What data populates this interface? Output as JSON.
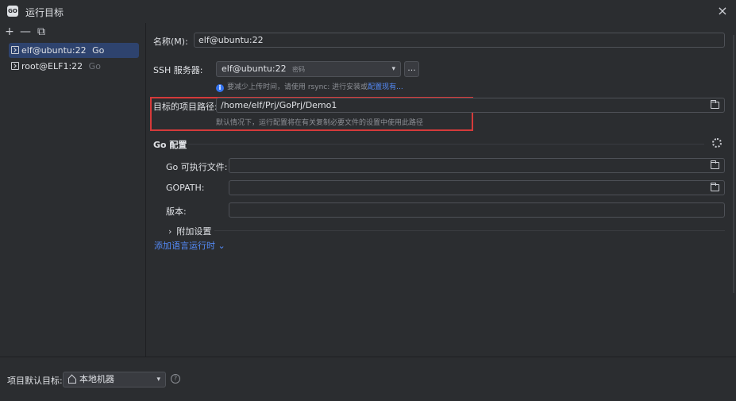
{
  "window": {
    "app_icon_text": "GO",
    "title": "运行目标",
    "close_glyph": "×"
  },
  "sidebar": {
    "toolbar": {
      "add": "+",
      "remove": "—",
      "copy": "⧉"
    },
    "items": [
      {
        "name": "elf@ubuntu:22",
        "type": "Go",
        "selected": true
      },
      {
        "name": "root@ELF1:22",
        "type": "Go",
        "selected": false
      }
    ]
  },
  "main": {
    "name_label": "名称(M):",
    "name_value": "elf@ubuntu:22",
    "ssh_label": "SSH 服务器:",
    "ssh_value": "elf@ubuntu:22",
    "ssh_sub": "密码",
    "ssh_more": "...",
    "info_text": "要减少上传时间，请使用 rsync: 进行安装或",
    "info_link": "配置现有...",
    "path_label": "目标的项目路径:",
    "path_value": "/home/elf/Prj/GoPrj/Demo1",
    "path_hint": "默认情况下，运行配置将在有关复制必要文件的设置中使用此路径",
    "go_section": "Go 配置",
    "go_exec_label": "Go 可执行文件:",
    "go_exec_value": "",
    "gopath_label": "GOPATH:",
    "gopath_value": "",
    "version_label": "版本:",
    "version_value": "",
    "extra_settings": "附加设置",
    "add_runtime": "添加语言运行时"
  },
  "footer": {
    "default_target_label": "项目默认目标:",
    "default_target_value": "本地机器",
    "help": "?"
  },
  "colors": {
    "accent": "#548af7",
    "selection": "#2e436e",
    "highlight": "#d53a3a",
    "background": "#2b2d30"
  }
}
